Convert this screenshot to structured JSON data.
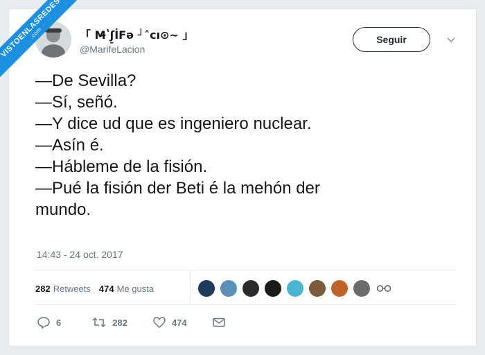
{
  "watermark": {
    "main": "VISTOENLASREDES",
    "sub": ".com"
  },
  "author": {
    "display_name": "「 M̴̵ʽʃ̠İFә ┘˄cı⊙~ 」",
    "handle": "@MarifeLacion"
  },
  "follow_label": "Seguir",
  "tweet_lines": [
    "—De Sevilla?",
    "—Sí, señó.",
    "—Y dice ud que es ingeniero nuclear.",
    "—Asín é.",
    "—Hábleme de la fisión.",
    "—Pué la fisión der Beti é la mehón der",
    "mundo."
  ],
  "timestamp": "14:43 - 24 oct. 2017",
  "stats": {
    "retweets_count": "282",
    "retweets_label": "Retweets",
    "likes_count": "474",
    "likes_label": "Me gusta"
  },
  "liker_colors": [
    "#1f3a5a",
    "#5a8fb8",
    "#2b2b2b",
    "#1a1a1a",
    "#4ab5d0",
    "#7a5a3a",
    "#c0622a",
    "#6b6b6b"
  ],
  "actions": {
    "replies": "6",
    "retweets": "282",
    "likes": "474"
  },
  "colors": {
    "brand_blue": "#1b8fe0",
    "text": "#14171a",
    "muted": "#657786"
  }
}
